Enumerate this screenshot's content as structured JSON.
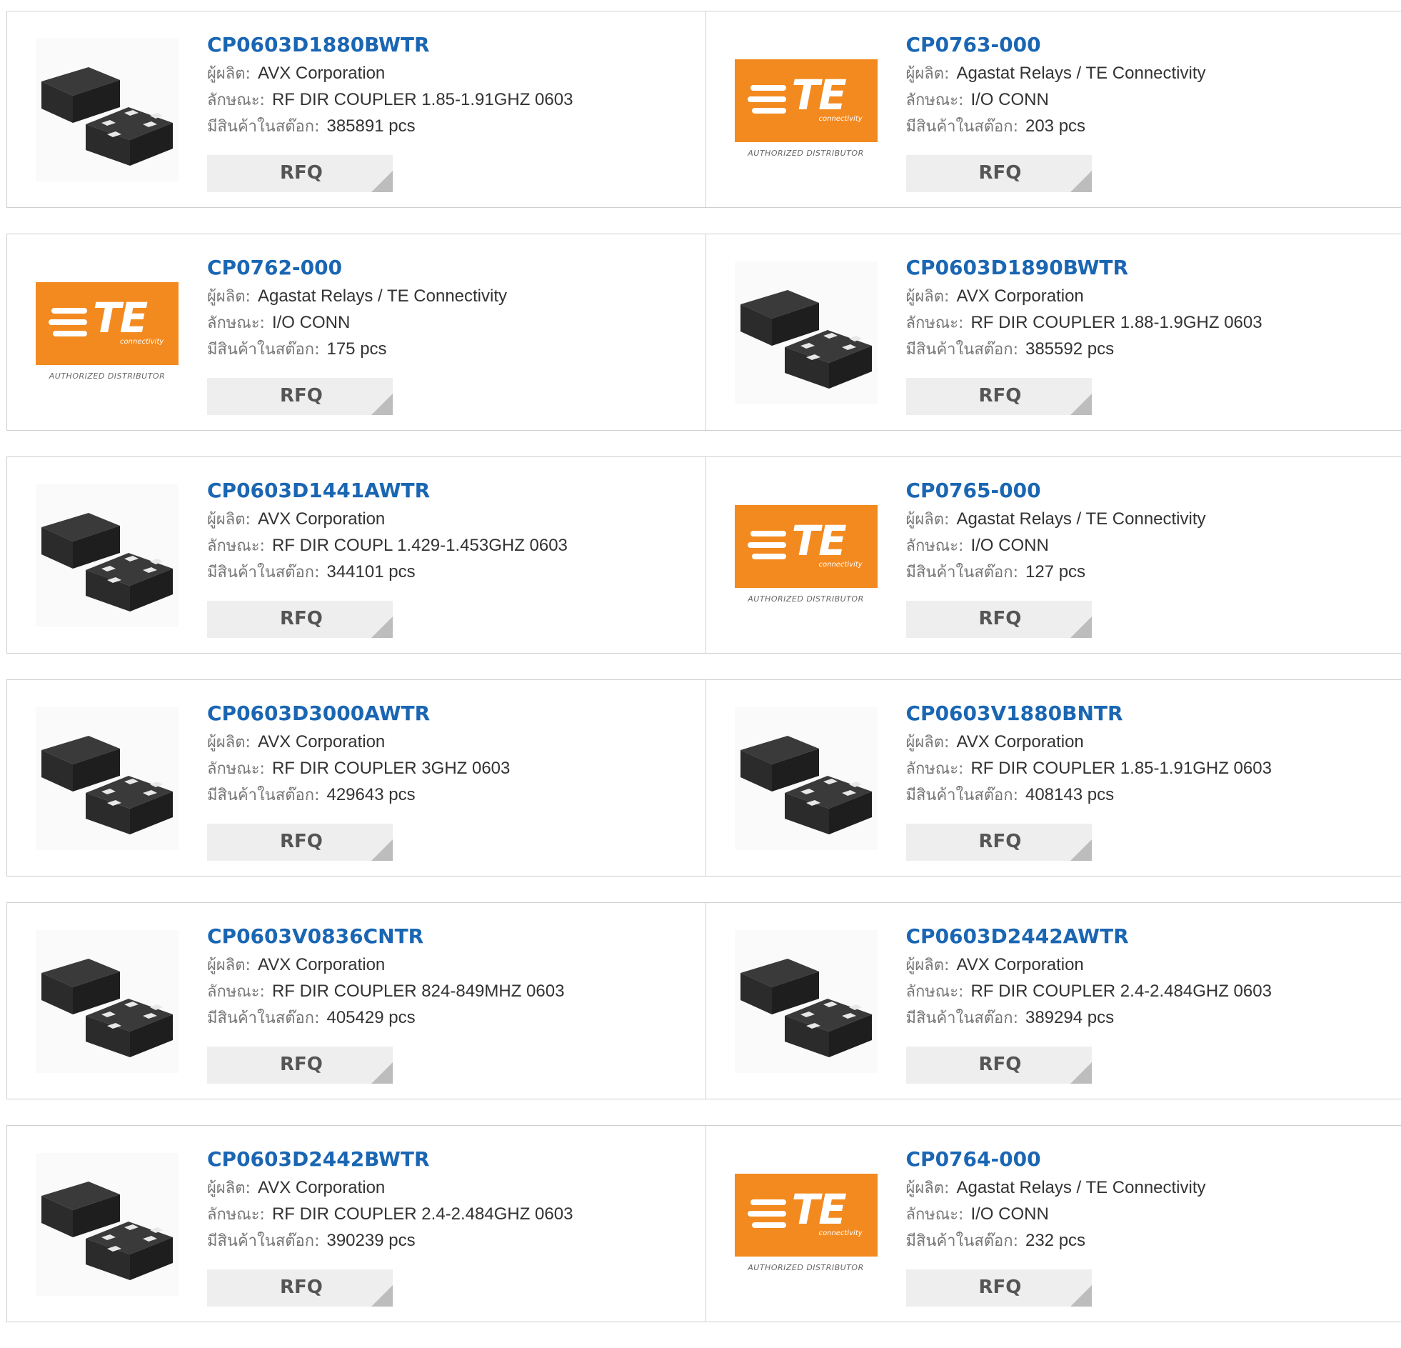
{
  "labels": {
    "manufacturer": "ผู้ผลิต:",
    "description": "ลักษณะ:",
    "stock": "มีสินค้าในสต๊อก:",
    "rfq": "RFQ"
  },
  "te_logo": {
    "text": "TE",
    "sub": "connectivity",
    "tagline": "AUTHORIZED DISTRIBUTOR",
    "color": "#f38a1f"
  },
  "chip_color": "#2b2b2b",
  "link_color": "#1a66b3",
  "products": [
    {
      "part": "CP0603D1880BWTR",
      "image": "chip",
      "manufacturer": "AVX Corporation",
      "description": "RF DIR COUPLER 1.85-1.91GHZ 0603",
      "stock": "385891 pcs"
    },
    {
      "part": "CP0763-000",
      "image": "te-logo",
      "manufacturer": "Agastat Relays / TE Connectivity",
      "description": "I/O CONN",
      "stock": "203 pcs"
    },
    {
      "part": "CP0762-000",
      "image": "te-logo",
      "manufacturer": "Agastat Relays / TE Connectivity",
      "description": "I/O CONN",
      "stock": "175 pcs"
    },
    {
      "part": "CP0603D1890BWTR",
      "image": "chip",
      "manufacturer": "AVX Corporation",
      "description": "RF DIR COUPLER 1.88-1.9GHZ 0603",
      "stock": "385592 pcs"
    },
    {
      "part": "CP0603D1441AWTR",
      "image": "chip",
      "manufacturer": "AVX Corporation",
      "description": "RF DIR COUPL 1.429-1.453GHZ 0603",
      "stock": "344101 pcs"
    },
    {
      "part": "CP0765-000",
      "image": "te-logo",
      "manufacturer": "Agastat Relays / TE Connectivity",
      "description": "I/O CONN",
      "stock": "127 pcs"
    },
    {
      "part": "CP0603D3000AWTR",
      "image": "chip",
      "manufacturer": "AVX Corporation",
      "description": "RF DIR COUPLER 3GHZ 0603",
      "stock": "429643 pcs"
    },
    {
      "part": "CP0603V1880BNTR",
      "image": "chip",
      "manufacturer": "AVX Corporation",
      "description": "RF DIR COUPLER 1.85-1.91GHZ 0603",
      "stock": "408143 pcs"
    },
    {
      "part": "CP0603V0836CNTR",
      "image": "chip",
      "manufacturer": "AVX Corporation",
      "description": "RF DIR COUPLER 824-849MHZ 0603",
      "stock": "405429 pcs"
    },
    {
      "part": "CP0603D2442AWTR",
      "image": "chip",
      "manufacturer": "AVX Corporation",
      "description": "RF DIR COUPLER 2.4-2.484GHZ 0603",
      "stock": "389294 pcs"
    },
    {
      "part": "CP0603D2442BWTR",
      "image": "chip",
      "manufacturer": "AVX Corporation",
      "description": "RF DIR COUPLER 2.4-2.484GHZ 0603",
      "stock": "390239 pcs"
    },
    {
      "part": "CP0764-000",
      "image": "te-logo",
      "manufacturer": "Agastat Relays / TE Connectivity",
      "description": "I/O CONN",
      "stock": "232 pcs"
    }
  ]
}
